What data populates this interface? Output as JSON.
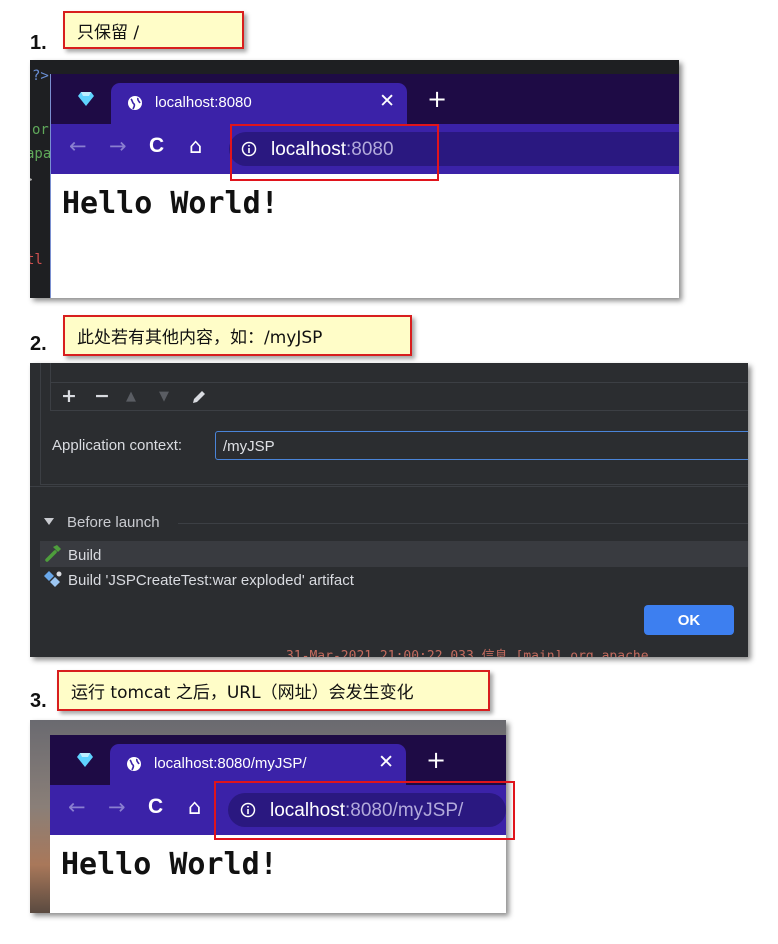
{
  "steps": [
    {
      "number": "1.",
      "callout": "只保留 /"
    },
    {
      "number": "2.",
      "callout": "此处若有其他内容，如：/myJSP"
    },
    {
      "number": "3.",
      "callout": "运行 tomcat 之后，URL（网址）会发生变化"
    }
  ],
  "browser1": {
    "tab_title": "localhost:8080",
    "url_host": "localhost",
    "url_rest": ":8080",
    "page_text": "Hello World!"
  },
  "browser3": {
    "tab_title": "localhost:8080/myJSP/",
    "url_host": "localhost",
    "url_rest": ":8080/myJSP/",
    "page_text": "Hello World!"
  },
  "browser_toolbar": {
    "tab_close": "✕",
    "new_tab": "+",
    "back": "←",
    "forward": "→",
    "reload": "C",
    "home": "⌂"
  },
  "ide_dialog": {
    "toolbar": {
      "add": "+",
      "remove": "−",
      "up": "▲",
      "down": "▼"
    },
    "app_context_label": "Application context:",
    "app_context_value": "/myJSP",
    "before_launch_title": "Before launch",
    "tasks": [
      "Build",
      "Build 'JSPCreateTest:war exploded' artifact"
    ],
    "ok_label": "OK",
    "log_snippet": "31-Mar-2021 21:00:22.033 信息 [main] org.apache"
  },
  "code_fragments": [
    "?>",
    "or",
    "apa",
    ">",
    "tl"
  ],
  "colors": {
    "callout_bg": "#fffdc8",
    "callout_border": "#d81e1e",
    "highlight_red": "#e0141c",
    "browser_tabbar": "#1e0b45",
    "browser_toolbar": "#3b22a8",
    "ide_bg": "#2b2d30",
    "ok_button": "#3d7ff0"
  }
}
